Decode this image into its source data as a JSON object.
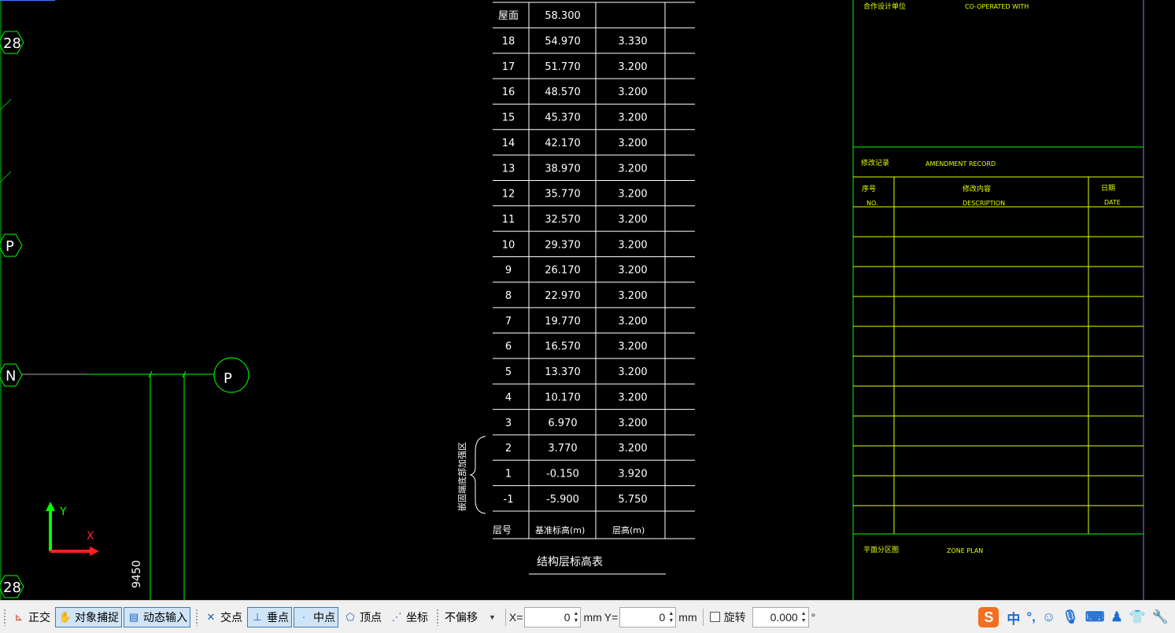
{
  "grid_bubbles": {
    "top_left": "28",
    "mid_left": "P",
    "n_left": "N",
    "p_right": "P",
    "bottom_left": "28"
  },
  "dimension": "9450",
  "ucs": {
    "x": "X",
    "y": "Y"
  },
  "floor_table": {
    "title": "结构层标高表",
    "headers": {
      "no": "层号",
      "elev": "基准标高(m)",
      "height": "层高(m)"
    },
    "brace_label": "嵌固端底部加强区",
    "rows": [
      {
        "no": "屋面",
        "elev": "58.300",
        "height": ""
      },
      {
        "no": "18",
        "elev": "54.970",
        "height": "3.330"
      },
      {
        "no": "17",
        "elev": "51.770",
        "height": "3.200"
      },
      {
        "no": "16",
        "elev": "48.570",
        "height": "3.200"
      },
      {
        "no": "15",
        "elev": "45.370",
        "height": "3.200"
      },
      {
        "no": "14",
        "elev": "42.170",
        "height": "3.200"
      },
      {
        "no": "13",
        "elev": "38.970",
        "height": "3.200"
      },
      {
        "no": "12",
        "elev": "35.770",
        "height": "3.200"
      },
      {
        "no": "11",
        "elev": "32.570",
        "height": "3.200"
      },
      {
        "no": "10",
        "elev": "29.370",
        "height": "3.200"
      },
      {
        "no": "9",
        "elev": "26.170",
        "height": "3.200"
      },
      {
        "no": "8",
        "elev": "22.970",
        "height": "3.200"
      },
      {
        "no": "7",
        "elev": "19.770",
        "height": "3.200"
      },
      {
        "no": "6",
        "elev": "16.570",
        "height": "3.200"
      },
      {
        "no": "5",
        "elev": "13.370",
        "height": "3.200"
      },
      {
        "no": "4",
        "elev": "10.170",
        "height": "3.200"
      },
      {
        "no": "3",
        "elev": "6.970",
        "height": "3.200"
      },
      {
        "no": "2",
        "elev": "3.770",
        "height": "3.200"
      },
      {
        "no": "1",
        "elev": "-0.150",
        "height": "3.920"
      },
      {
        "no": "-1",
        "elev": "-5.900",
        "height": "5.750"
      }
    ]
  },
  "title_block": {
    "cooperated_cn": "合作设计单位",
    "cooperated_en": "CO-OPERATED WITH",
    "amend_cn": "修改记录",
    "amend_en": "AMENDMENT RECORD",
    "col_no_cn": "序号",
    "col_no_en": "NO.",
    "col_desc_cn": "修改内容",
    "col_desc_en": "DESCRIPTION",
    "col_date_cn": "日期",
    "col_date_en": "DATE",
    "zone_cn": "平面分区图",
    "zone_en": "ZONE PLAN"
  },
  "statusbar": {
    "ortho": "正交",
    "osnap": "对象捕捉",
    "dyn": "动态输入",
    "intersection": "交点",
    "perpendicular": "垂点",
    "midpoint": "中点",
    "vertex": "顶点",
    "coord": "坐标",
    "offset_select": "不偏移",
    "x_label": "X=",
    "x_value": "0",
    "unit": "mm",
    "y_label": "Y=",
    "y_value": "0",
    "rotate_label": "旋转",
    "rotate_value": "0.000",
    "degree": "°",
    "ime_logo": "S",
    "ime_chinese": "中",
    "ime_punct": "°,"
  },
  "colors": {
    "cad_bg": "#000000",
    "line_white": "#ffffff",
    "line_green": "#00ff00",
    "title_yellow": "#e6ff00",
    "frame_purple": "#8080ff"
  }
}
